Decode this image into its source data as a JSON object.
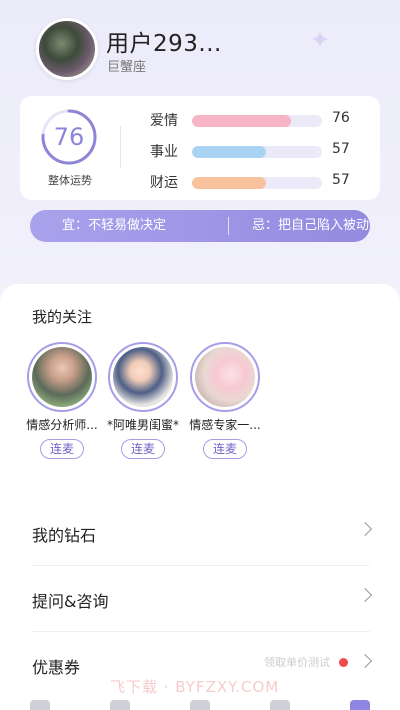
{
  "profile": {
    "username": "用户293...",
    "zodiac": "巨蟹座",
    "star_icon": "sparkle-icon"
  },
  "fortune": {
    "overall_score": "76",
    "overall_label": "整体运势",
    "overall_fraction": 0.76,
    "items": [
      {
        "label": "爱情",
        "value": "76",
        "fraction": 0.76,
        "color": "#f6b4c6"
      },
      {
        "label": "事业",
        "value": "57",
        "fraction": 0.57,
        "color": "#a9d3f2"
      },
      {
        "label": "财运",
        "value": "57",
        "fraction": 0.57,
        "color": "#f7c29c"
      }
    ]
  },
  "advice": {
    "yi": "宜：不轻易做决定",
    "ji": "忌：把自己陷入被动"
  },
  "following": {
    "title": "我的关注",
    "items": [
      {
        "name": "情感分析师...",
        "button": "连麦"
      },
      {
        "name": "*阿唯男闺蜜*",
        "button": "连麦"
      },
      {
        "name": "情感专家一...",
        "button": "连麦"
      }
    ]
  },
  "menu": {
    "diamonds": "我的钻石",
    "consult": "提问&咨询",
    "coupons": "优惠券",
    "coupon_note": "领取单价测试"
  },
  "watermark": "飞下载 · BYFZXY.COM",
  "colors": {
    "accent": "#8d86d8",
    "advice_bg": "#a49de9",
    "red_dot": "#f04a4a"
  }
}
